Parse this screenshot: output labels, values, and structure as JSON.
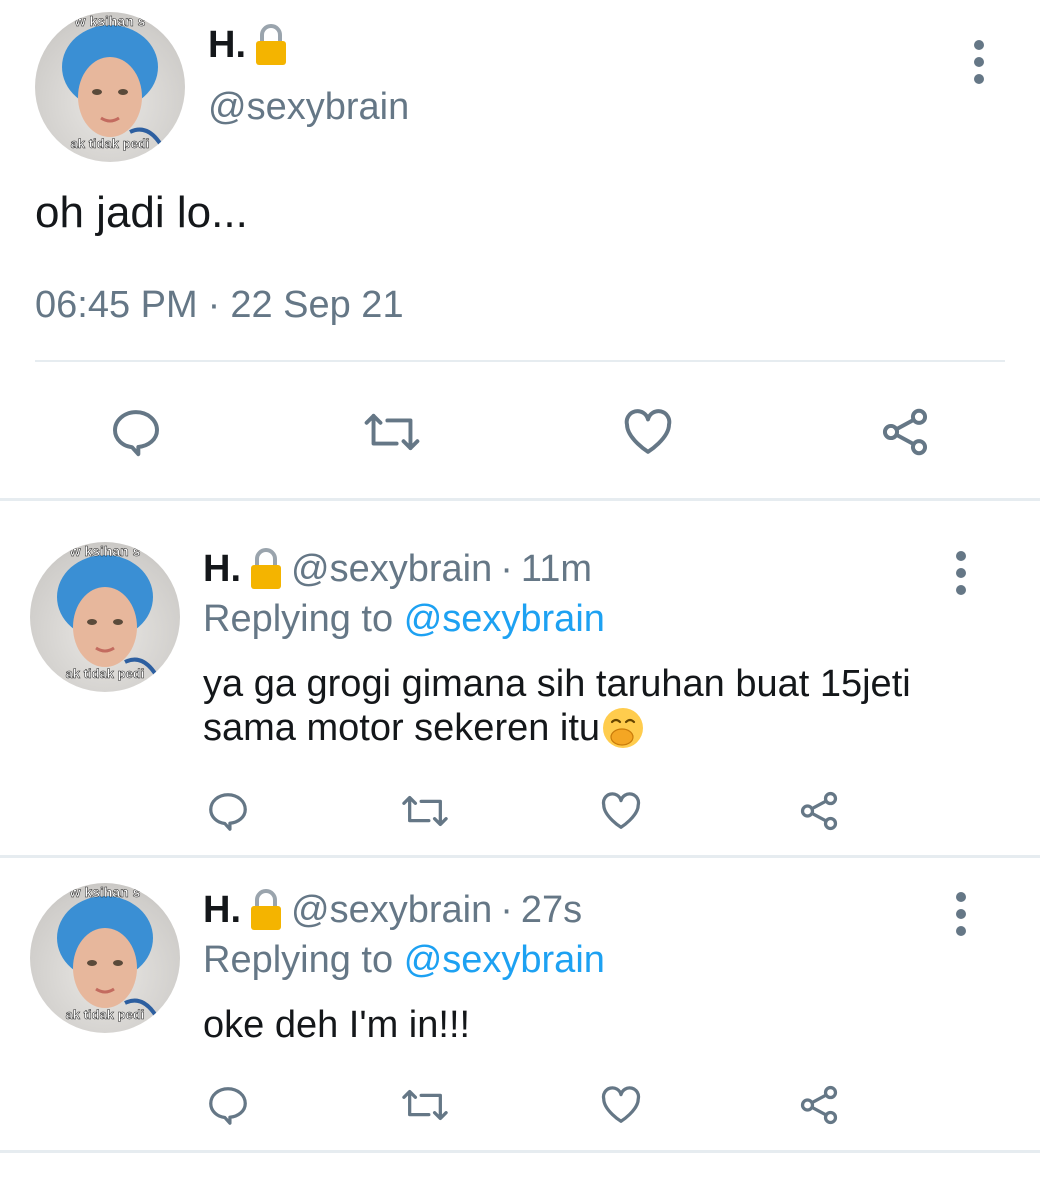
{
  "main_tweet": {
    "display_name": "H.",
    "lock_icon": "lock-icon",
    "handle": "@sexybrain",
    "text": "oh jadi lo...",
    "time": "06:45 PM",
    "separator": "·",
    "date": "22 Sep 21",
    "avatar": {
      "caption_top": "w ksihan s",
      "caption_bottom": "ak tidak pedi"
    },
    "actions": [
      "reply-icon",
      "retweet-icon",
      "like-icon",
      "share-icon"
    ]
  },
  "replies": [
    {
      "display_name": "H.",
      "handle": "@sexybrain",
      "separator": "·",
      "age": "11m",
      "replying_label": "Replying to",
      "replying_handle": "@sexybrain",
      "text_line1": "ya ga grogi gimana sih taruhan buat 15jeti",
      "text_line2": "sama motor sekeren itu",
      "emoji": "🤭",
      "avatar": {
        "caption_top": "w ksihan s",
        "caption_bottom": "ak tidak pedi"
      }
    },
    {
      "display_name": "H.",
      "handle": "@sexybrain",
      "separator": "·",
      "age": "27s",
      "replying_label": "Replying to",
      "replying_handle": "@sexybrain",
      "text_line1": "oke deh I'm in!!!",
      "avatar": {
        "caption_top": "w ksihan s",
        "caption_bottom": "ak tidak pedi"
      }
    }
  ],
  "colors": {
    "text": "#14171a",
    "muted": "#657786",
    "link": "#1da1f2",
    "divider": "#e6ecf0",
    "lock": "#f4b400"
  }
}
